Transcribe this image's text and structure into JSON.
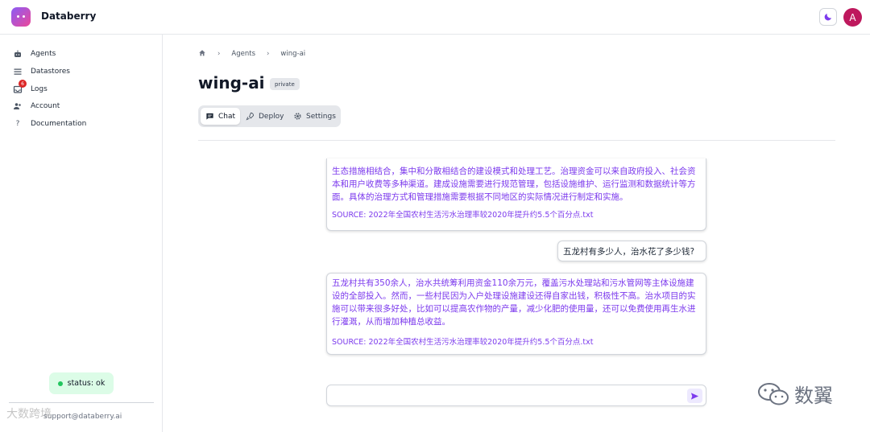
{
  "app": {
    "brand": "Databerry",
    "avatar_initial": "A"
  },
  "sidebar": {
    "items": [
      {
        "label": "Agents",
        "icon": "robot-icon"
      },
      {
        "label": "Datastores",
        "icon": "list-icon"
      },
      {
        "label": "Logs",
        "icon": "inbox-icon",
        "badge": "6"
      },
      {
        "label": "Account",
        "icon": "users-icon"
      },
      {
        "label": "Documentation",
        "icon": "help-icon"
      }
    ],
    "status": "status: ok",
    "support_email": "support@databerry.ai"
  },
  "breadcrumb": {
    "section": "Agents",
    "current": "wing-ai"
  },
  "page": {
    "title": "wing-ai",
    "visibility": "private"
  },
  "tabs": [
    {
      "label": "Chat",
      "active": true
    },
    {
      "label": "Deploy",
      "active": false
    },
    {
      "label": "Settings",
      "active": false
    }
  ],
  "chat": {
    "messages": [
      {
        "from": "agent",
        "text": "生态措施相结合，集中和分散相结合的建设模式和处理工艺。治理资金可以来自政府投入、社会资本和用户收费等多种渠道。建成设施需要进行规范管理，包括设施维护、运行监测和数据统计等方面。具体的治理方式和管理措施需要根据不同地区的实际情况进行制定和实施。",
        "source": "SOURCE: 2022年全国农村生活污水治理率较2020年提升约5.5个百分点.txt"
      },
      {
        "from": "user",
        "text": "五龙村有多少人，治水花了多少钱?"
      },
      {
        "from": "agent",
        "text": "五龙村共有350余人，治水共统筹利用资金110余万元，覆盖污水处理站和污水管网等主体设施建设的全部投入。然而，一些村民因为入户处理设施建设还得自家出钱，积极性不高。治水项目的实施可以带来很多好处，比如可以提高农作物的产量，减少化肥的使用量，还可以免费使用再生水进行灌溉，从而增加种植总收益。",
        "source": "SOURCE: 2022年全国农村生活污水治理率较2020年提升约5.5个百分点.txt"
      }
    ],
    "input_placeholder": ""
  },
  "watermarks": {
    "left": "大数跨境",
    "right": "数翼"
  },
  "colors": {
    "accent": "#7c3aed",
    "avatar": "#be185d",
    "status_bg": "#dcfce7",
    "status_dot": "#22c55e",
    "badge": "#dc2626"
  }
}
